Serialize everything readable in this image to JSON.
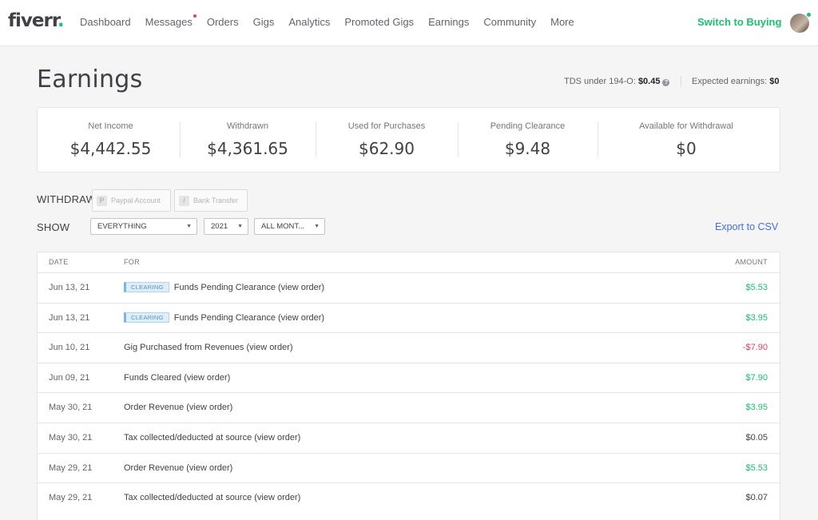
{
  "nav": {
    "logo_text": "fiverr",
    "logo_dot": ".",
    "items": [
      "Dashboard",
      "Messages",
      "Orders",
      "Gigs",
      "Analytics",
      "Promoted Gigs",
      "Earnings",
      "Community",
      "More"
    ],
    "switch_label": "Switch to Buying"
  },
  "header": {
    "title": "Earnings",
    "tds_label": "TDS under 194-O:",
    "tds_value": "$0.45",
    "expected_label": "Expected earnings:",
    "expected_value": "$0"
  },
  "summary": [
    {
      "label": "Net Income",
      "value": "$4,442.55"
    },
    {
      "label": "Withdrawn",
      "value": "$4,361.65"
    },
    {
      "label": "Used for Purchases",
      "value": "$62.90"
    },
    {
      "label": "Pending Clearance",
      "value": "$9.48"
    },
    {
      "label": "Available for Withdrawal",
      "value": "$0"
    }
  ],
  "withdraw": {
    "label": "WITHDRAW",
    "paypal_label": "Paypal Account",
    "bank_label": "Bank Transfer"
  },
  "filters": {
    "label": "SHOW",
    "type_value": "EVERYTHING",
    "year_value": "2021",
    "month_value": "ALL MONT...",
    "export_label": "Export to CSV"
  },
  "table": {
    "headers": {
      "date": "DATE",
      "for": "FOR",
      "amount": "AMOUNT"
    },
    "rows": [
      {
        "date": "Jun 13, 21",
        "badge": "CLEARING",
        "for": "Funds Pending Clearance (view order)",
        "amount": "$5.53",
        "kind": "positive"
      },
      {
        "date": "Jun 13, 21",
        "badge": "CLEARING",
        "for": "Funds Pending Clearance (view order)",
        "amount": "$3.95",
        "kind": "positive"
      },
      {
        "date": "Jun 10, 21",
        "badge": "",
        "for": "Gig Purchased from Revenues (view order)",
        "amount": "-$7.90",
        "kind": "negative"
      },
      {
        "date": "Jun 09, 21",
        "badge": "",
        "for": "Funds Cleared (view order)",
        "amount": "$7.90",
        "kind": "positive"
      },
      {
        "date": "May 30, 21",
        "badge": "",
        "for": "Order Revenue (view order)",
        "amount": "$3.95",
        "kind": "positive"
      },
      {
        "date": "May 30, 21",
        "badge": "",
        "for": "Tax collected/deducted at source (view order)",
        "amount": "$0.05",
        "kind": "neutral"
      },
      {
        "date": "May 29, 21",
        "badge": "",
        "for": "Order Revenue (view order)",
        "amount": "$5.53",
        "kind": "positive"
      },
      {
        "date": "May 29, 21",
        "badge": "",
        "for": "Tax collected/deducted at source (view order)",
        "amount": "$0.07",
        "kind": "neutral"
      }
    ]
  },
  "colors": {
    "brand": "#1dbf73",
    "positive": "#1dbf73",
    "negative": "#e0455c",
    "neutral": "#404145",
    "link": "#446ee7"
  }
}
